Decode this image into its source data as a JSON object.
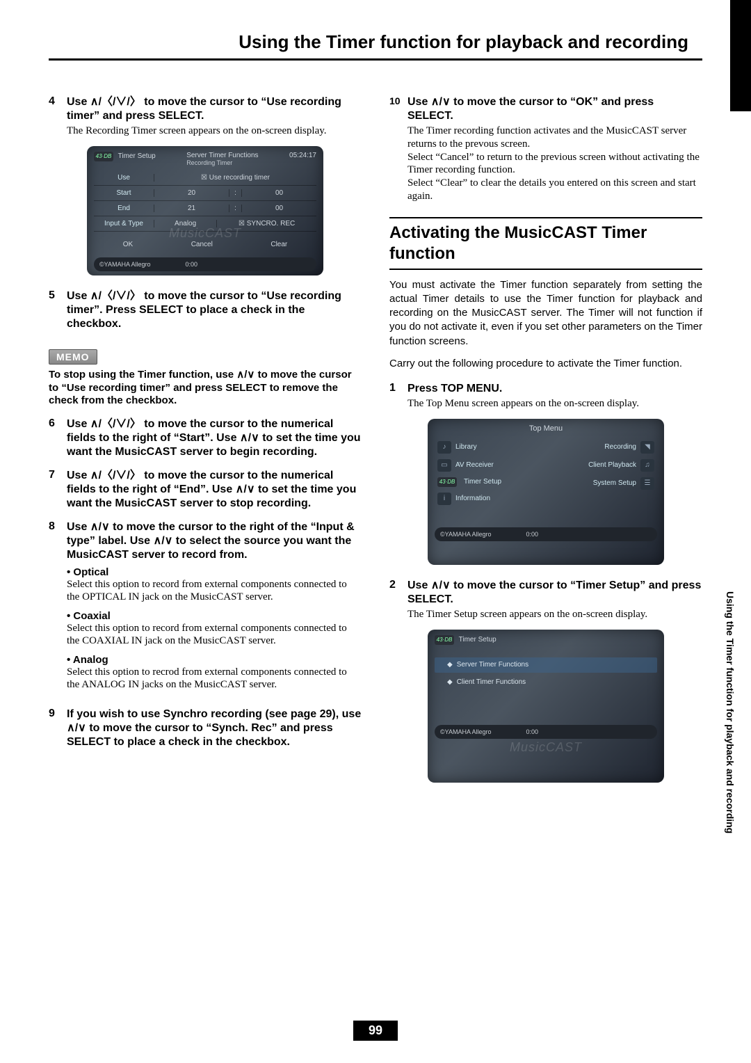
{
  "title": "Using the Timer function for playback and recording",
  "side_label": "Using the Timer function for playback and recording",
  "page_number": "99",
  "memo": {
    "label": "MEMO",
    "text": "To stop using the Timer function, use ∧/∨ to move the cursor to “Use recording timer” and press SELECT to remove the check from the checkbox."
  },
  "left_steps": {
    "s4": {
      "num": "4",
      "heading": "Use ∧/〈/∨/〉 to move the cursor to “Use recording timer” and press SELECT.",
      "text": "The Recording Timer screen appears on the on-screen display."
    },
    "s5": {
      "num": "5",
      "heading": "Use ∧/〈/∨/〉 to move the cursor to “Use recording timer”. Press SELECT to place a check in the checkbox."
    },
    "s6": {
      "num": "6",
      "heading": "Use ∧/〈/∨/〉 to move the cursor to the numerical fields to the right of “Start”. Use ∧/∨ to set the time you want the MusicCAST server to begin recording."
    },
    "s7": {
      "num": "7",
      "heading": "Use ∧/〈/∨/〉 to move the cursor to the numerical fields to the right of “End”. Use ∧/∨ to set the time you want the MusicCAST server to stop recording."
    },
    "s8": {
      "num": "8",
      "heading": "Use ∧/∨ to move the cursor to the right of the “Input & type” label. Use ∧/∨ to select the source you want the MusicCAST server to record from."
    },
    "s9": {
      "num": "9",
      "heading": "If you wish to use Synchro recording (see page 29), use ∧/∨ to move the cursor to “Synch. Rec” and press SELECT to place a check in the checkbox."
    }
  },
  "bullets": {
    "optical": {
      "title": "Optical",
      "text": "Select this option to record from external components connected to the OPTICAL IN jack on the MusicCAST server."
    },
    "coaxial": {
      "title": "Coaxial",
      "text": "Select this option to record from external components connected to the COAXIAL IN jack on the MusicCAST server."
    },
    "analog": {
      "title": "Analog",
      "text": "Select this option to recrod from external components connected to the ANALOG IN jacks on the MusicCAST server."
    }
  },
  "right_steps": {
    "s10": {
      "num": "10",
      "heading": "Use ∧/∨ to move the cursor to “OK” and press SELECT.",
      "text": "The Timer recording function activates and the MusicCAST server returns to the prevous screen.\nSelect “Cancel” to return to the previous screen without activating the Timer recording function.\nSelect “Clear” to clear the details you entered on this screen and start again."
    },
    "s1": {
      "num": "1",
      "heading": "Press TOP MENU.",
      "text": "The Top Menu screen appears on the on-screen display."
    },
    "s2": {
      "num": "2",
      "heading": "Use ∧/∨ to move the cursor to “Timer Setup” and press SELECT.",
      "text": "The Timer Setup screen appears on the on-screen display."
    }
  },
  "section": {
    "heading": "Activating the MusicCAST Timer function",
    "body1": "You must activate the Timer function separately from setting the actual Timer details to use the Timer function for playback and recording on the MusicCAST server. The Timer will not function if you do not activate it, even if you set other parameters on the Timer function screens.",
    "body2": "Carry out the following procedure to activate the Timer function."
  },
  "ss1": {
    "tab": "Timer Setup",
    "title": "Server Timer Functions",
    "subtitle": "Recording Timer",
    "clock": "05:24:17",
    "rows": {
      "use": {
        "label": "Use",
        "v1": "☒ Use recording timer",
        "v2": "",
        "v3": ""
      },
      "start": {
        "label": "Start",
        "v1": "20",
        "v2": ":",
        "v3": "00"
      },
      "end": {
        "label": "End",
        "v1": "21",
        "v2": ":",
        "v3": "00"
      },
      "inp": {
        "label": "Input & Type",
        "v1": "Analog",
        "v2": "",
        "v3": "☒ SYNCRO. REC"
      }
    },
    "buttons": {
      "ok": "OK",
      "cancel": "Cancel",
      "clear": "Clear"
    },
    "footer_brand": "©YAMAHA  Allegro",
    "footer_time": "0:00",
    "watermark": "MusicCAST"
  },
  "ss2": {
    "title": "Top Menu",
    "left_items": [
      "Library",
      "AV Receiver",
      "Timer Setup",
      "Information"
    ],
    "right_items": [
      "Recording",
      "Client Playback",
      "System Setup"
    ],
    "footer_brand": "©YAMAHA  Allegro",
    "footer_time": "0:00"
  },
  "ss3": {
    "tab": "Timer Setup",
    "options": [
      "Server Timer Functions",
      "Client Timer Functions"
    ],
    "watermark": "MusicCAST",
    "footer_brand": "©YAMAHA  Allegro",
    "footer_time": "0:00"
  }
}
